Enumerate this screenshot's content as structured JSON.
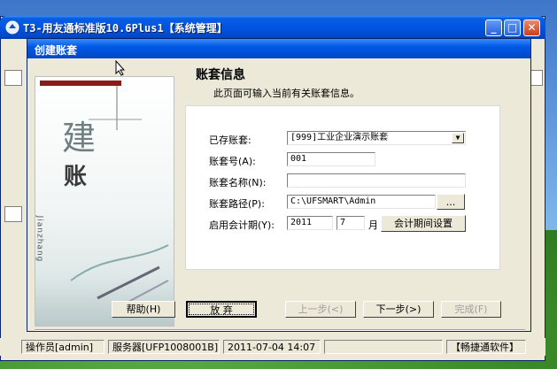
{
  "window": {
    "title": "T3-用友通标准版10.6Plus1【系统管理】",
    "minimize": "_",
    "maximize": "□",
    "close": "✕"
  },
  "dialog": {
    "title": "创建账套",
    "header_title": "账套信息",
    "header_desc": "此页面可输入当前有关账套信息。"
  },
  "art": {
    "char1": "建",
    "char2": "账",
    "vertical": "Jianzhang"
  },
  "form": {
    "existing_label": "已存账套:",
    "existing_value": "[999]工业企业演示账套",
    "code_label": "账套号(A):",
    "code_value": "001",
    "name_label": "账套名称(N):",
    "name_value": "",
    "path_label": "账套路径(P):",
    "path_value": "C:\\UFSMART\\Admin",
    "browse_label": "...",
    "period_label": "启用会计期(Y):",
    "year_value": "2011",
    "month_value": "7",
    "month_unit": "月",
    "period_btn": "会计期间设置"
  },
  "buttons": {
    "help": "帮助(H)",
    "cancel": "放 弃",
    "prev": "上一步(<)",
    "next": "下一步(>)",
    "finish": "完成(F)"
  },
  "status": {
    "operator": "操作员[admin]",
    "server": "服务器[UFP1008001B]",
    "datetime": "2011-07-04 14:07",
    "brand": "【畅捷通软件】"
  }
}
